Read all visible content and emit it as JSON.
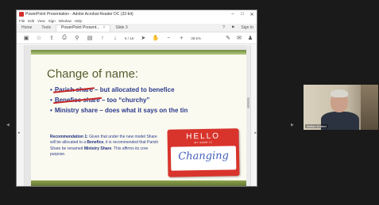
{
  "window": {
    "title": "PowerPoint Presentation - Adobe Acrobat Reader DC (32-bit)",
    "controls": [
      "–",
      "□",
      "✕"
    ]
  },
  "menu": [
    "File",
    "Edit",
    "View",
    "Sign",
    "Window",
    "Help"
  ],
  "tabs": [
    {
      "label": "Home"
    },
    {
      "label": "Tools"
    },
    {
      "label": "PowerPoint Present...",
      "close": "×"
    },
    {
      "label": "Slide 3"
    }
  ],
  "tabbar_right": {
    "help": "?",
    "bell": "🔔",
    "signin": "Sign In"
  },
  "toolbar": {
    "page": "6 / 16",
    "zoom": "39.5%"
  },
  "slide": {
    "title": "Change of name:",
    "bullets": [
      {
        "struck": "Parish share",
        "rest": " – but allocated to benefice"
      },
      {
        "struck": "Benefice share",
        "rest": " – too “churchy”"
      },
      {
        "struck": "",
        "rest": "Ministry share – does what it says on the tin"
      }
    ],
    "recommendation": {
      "label": "Recommendation 1:",
      "text_1": "Given that under the new model Share will be allocated to a",
      "bold_1": "Benefice",
      "text_2": ", it is recommended that Parish Share be renamed",
      "bold_2": "Ministry Share",
      "text_3": ". This affirms its core purpose."
    },
    "sticker": {
      "header": "HELLO",
      "subheader": "MY NAME IS",
      "handwriting": "Changing"
    }
  },
  "video": {
    "participant_label": "Adrian Dorber"
  },
  "colors": {
    "slide_title": "#555c2c",
    "bullet_text": "#2b3a8c",
    "sticker_red": "#d8342c",
    "strike_red": "#c62828"
  }
}
